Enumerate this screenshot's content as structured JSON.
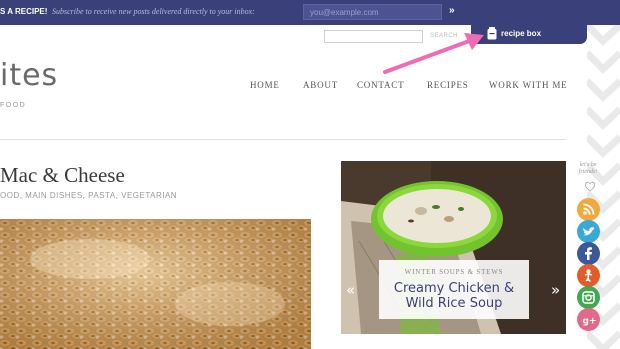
{
  "topbar": {
    "label": "S A RECIPE!",
    "text": "Subscribe to receive new posts delivered directly to your inbox:",
    "email_placeholder": "you@example.com",
    "submit_label": "»",
    "color": "#3a4079"
  },
  "recipe_box": {
    "label": "recipe box",
    "icon": "recipe-box-icon"
  },
  "search": {
    "button_label": "SEARCH"
  },
  "site": {
    "logo": "ites",
    "tagline": "FOOD"
  },
  "nav": {
    "items": [
      {
        "label": "HOME"
      },
      {
        "label": "ABOUT"
      },
      {
        "label": "CONTACT"
      },
      {
        "label": "RECIPES"
      },
      {
        "label": "WORK WITH ME"
      }
    ]
  },
  "post": {
    "title": "Mac & Cheese",
    "categories": "OOD, MAIN DISHES, PASTA, VEGETARIAN"
  },
  "slider": {
    "category": "WINTER SOUPS & STEWS",
    "title_line1": "Creamy Chicken &",
    "title_line2": "Wild Rice Soup",
    "prev": "«",
    "next": "»"
  },
  "social": {
    "label_line1": "let's be",
    "label_line2": "friends!",
    "buttons": [
      {
        "name": "rss",
        "icon": "rss-icon",
        "color": "#f2a93b"
      },
      {
        "name": "twitter",
        "icon": "twitter-icon",
        "color": "#3aa9d9"
      },
      {
        "name": "facebook",
        "icon": "facebook-icon",
        "color": "#3b5998"
      },
      {
        "name": "pinterest",
        "icon": "pinterest-icon",
        "color": "#e25c2a"
      },
      {
        "name": "instagram",
        "icon": "instagram-icon",
        "color": "#42a852"
      },
      {
        "name": "google-plus",
        "icon": "google-plus-icon",
        "color": "#e06a8a"
      }
    ]
  },
  "annotation": {
    "arrow_color": "#f06ab4"
  }
}
